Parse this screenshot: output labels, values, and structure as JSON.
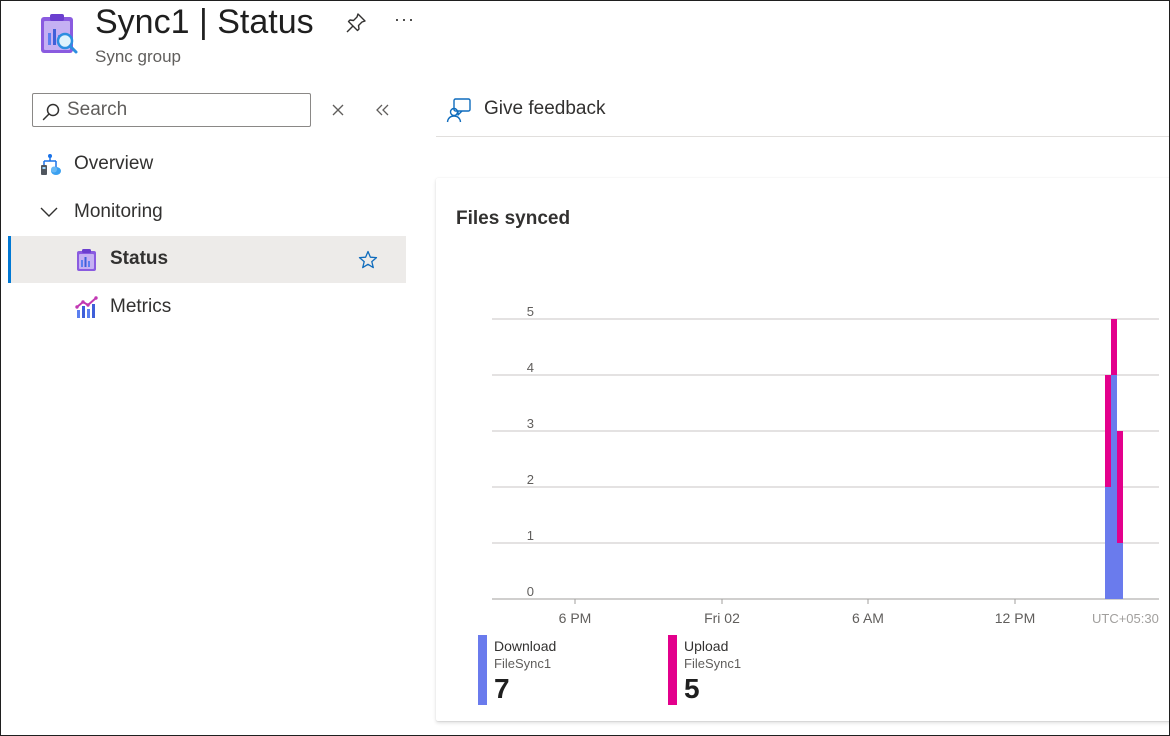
{
  "header": {
    "title_name": "Sync1",
    "title_separator": "|",
    "title_page": "Status",
    "subtitle": "Sync group",
    "more_label": "···"
  },
  "search": {
    "placeholder": "Search",
    "value": ""
  },
  "nav": {
    "overview": "Overview",
    "monitoring": "Monitoring",
    "status": "Status",
    "metrics": "Metrics"
  },
  "toolbar": {
    "feedback_label": "Give feedback"
  },
  "card": {
    "title": "Files synced"
  },
  "chart_data": {
    "type": "bar",
    "stacked": true,
    "y_ticks": [
      "0",
      "1",
      "2",
      "3",
      "4",
      "5"
    ],
    "ylim": [
      0,
      5
    ],
    "x_ticks": [
      "6 PM",
      "Fri 02",
      "6 AM",
      "12 PM"
    ],
    "timezone_label": "UTC+05:30",
    "grid": true,
    "buckets": [
      {
        "download": 2,
        "upload": 2
      },
      {
        "download": 4,
        "upload": 1
      },
      {
        "download": 1,
        "upload": 2
      }
    ],
    "series": [
      {
        "name": "Download",
        "resource": "FileSync1",
        "total": "7",
        "color": "#6a7bed"
      },
      {
        "name": "Upload",
        "resource": "FileSync1",
        "total": "5",
        "color": "#e3008c"
      }
    ]
  }
}
